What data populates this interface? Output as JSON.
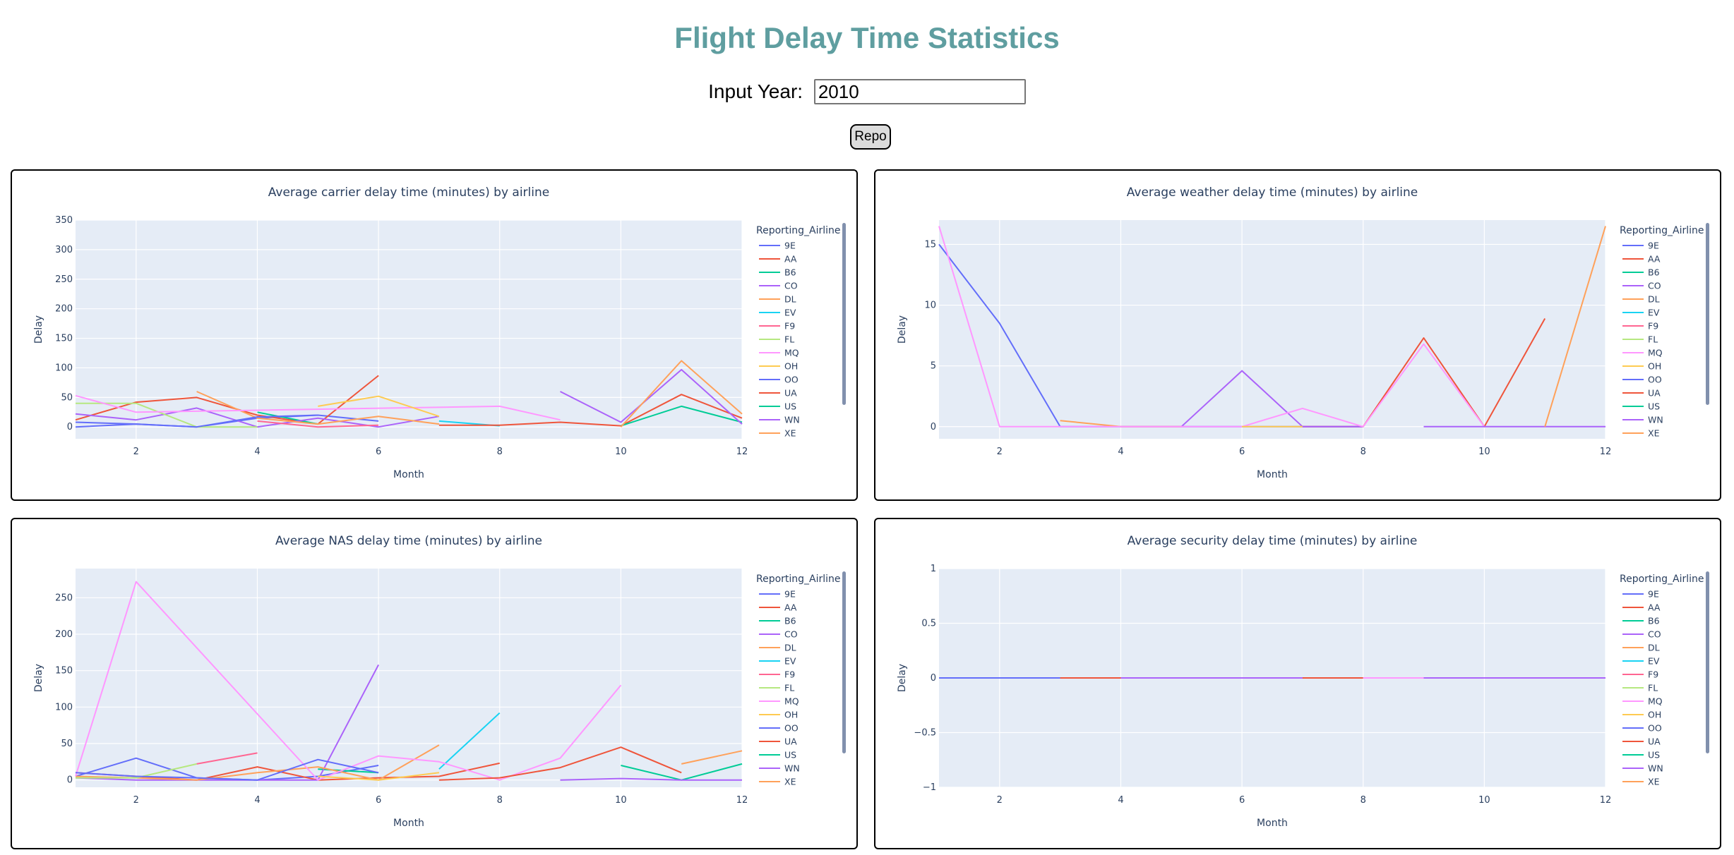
{
  "header": {
    "title": "Flight Delay Time Statistics",
    "year_label": "Input Year:",
    "year_value": "2010",
    "report_label": "Repo"
  },
  "legend_title": "Reporting_Airline",
  "airlines": [
    "9E",
    "AA",
    "B6",
    "CO",
    "DL",
    "EV",
    "F9",
    "FL",
    "MQ",
    "OH",
    "OO",
    "UA",
    "US",
    "WN",
    "XE"
  ],
  "colors": {
    "9E": "#636efa",
    "AA": "#ef553b",
    "B6": "#00cc96",
    "CO": "#ab63fa",
    "DL": "#ffa15a",
    "EV": "#19d3f3",
    "F9": "#ff6692",
    "FL": "#b6e880",
    "MQ": "#ff97ff",
    "OH": "#fecb52",
    "OO": "#636efa",
    "UA": "#ef553b",
    "US": "#00cc96",
    "WN": "#ab63fa",
    "XE": "#ffa15a",
    "plot_bg": "#e5ecf6",
    "title_color": "#5f9ea0"
  },
  "chart_data": [
    {
      "type": "line",
      "title": "Average carrier delay time (minutes) by airline",
      "xlabel": "Month",
      "ylabel": "Delay",
      "xlim": [
        1,
        12
      ],
      "ylim": [
        -20,
        350
      ],
      "xticks": [
        2,
        4,
        6,
        8,
        10,
        12
      ],
      "yticks": [
        0,
        50,
        100,
        150,
        200,
        250,
        300,
        350
      ],
      "ytick_labels": [
        "0",
        "50",
        "100",
        "150",
        "200",
        "250",
        "300",
        "350"
      ],
      "series": [
        {
          "name": "9E",
          "x": [
            1,
            2,
            3,
            4,
            5,
            6
          ],
          "y": [
            8,
            5,
            0,
            15,
            20,
            10
          ]
        },
        {
          "name": "AA",
          "x": [
            1,
            2,
            3,
            4,
            5,
            6
          ],
          "y": [
            12,
            42,
            50,
            20,
            5,
            87
          ]
        },
        {
          "name": "B6",
          "x": [
            4,
            5
          ],
          "y": [
            25,
            5
          ]
        },
        {
          "name": "CO",
          "x": [
            1,
            2,
            3,
            4,
            5,
            6,
            7
          ],
          "y": [
            22,
            12,
            32,
            0,
            15,
            0,
            18
          ]
        },
        {
          "name": "DL",
          "x": [
            3,
            4,
            5,
            6,
            7
          ],
          "y": [
            60,
            15,
            5,
            18,
            5
          ]
        },
        {
          "name": "EV",
          "x": [
            7,
            8
          ],
          "y": [
            10,
            2
          ]
        },
        {
          "name": "F9",
          "x": [
            4,
            5,
            6
          ],
          "y": [
            10,
            0,
            3
          ]
        },
        {
          "name": "FL",
          "x": [
            1,
            2,
            3,
            4
          ],
          "y": [
            40,
            40,
            0,
            0
          ]
        },
        {
          "name": "MQ",
          "x": [
            1,
            2,
            8,
            9
          ],
          "y": [
            53,
            25,
            35,
            12
          ]
        },
        {
          "name": "OH",
          "x": [
            5,
            6,
            7
          ],
          "y": [
            35,
            52,
            18
          ]
        },
        {
          "name": "OO",
          "x": [
            1,
            2,
            3,
            4,
            5
          ],
          "y": [
            0,
            5,
            0,
            17,
            20
          ]
        },
        {
          "name": "UA",
          "x": [
            7,
            8,
            9,
            10,
            11,
            12
          ],
          "y": [
            3,
            3,
            8,
            2,
            55,
            15
          ]
        },
        {
          "name": "US",
          "x": [
            10,
            11,
            12
          ],
          "y": [
            2,
            35,
            8
          ]
        },
        {
          "name": "WN",
          "x": [
            9,
            10,
            11,
            12
          ],
          "y": [
            60,
            8,
            97,
            5
          ]
        },
        {
          "name": "XE",
          "x": [
            10,
            11,
            12
          ],
          "y": [
            0,
            112,
            22
          ]
        }
      ]
    },
    {
      "type": "line",
      "title": "Average weather delay time (minutes) by airline",
      "xlabel": "Month",
      "ylabel": "Delay",
      "xlim": [
        1,
        12
      ],
      "ylim": [
        -1,
        17
      ],
      "xticks": [
        2,
        4,
        6,
        8,
        10,
        12
      ],
      "yticks": [
        0,
        5,
        10,
        15
      ],
      "ytick_labels": [
        "0",
        "5",
        "10",
        "15"
      ],
      "series": [
        {
          "name": "9E",
          "x": [
            1,
            2,
            3,
            4,
            5,
            6,
            7,
            8
          ],
          "y": [
            15,
            8.5,
            0,
            0,
            0,
            0,
            0,
            0
          ]
        },
        {
          "name": "AA",
          "x": [
            7,
            8,
            9,
            10,
            11
          ],
          "y": [
            0,
            0,
            7.3,
            0,
            8.9
          ]
        },
        {
          "name": "CO",
          "x": [
            4,
            5,
            6,
            7,
            8
          ],
          "y": [
            0,
            0,
            4.6,
            0,
            0
          ]
        },
        {
          "name": "DL",
          "x": [
            3,
            4,
            5
          ],
          "y": [
            0.5,
            0,
            0
          ]
        },
        {
          "name": "MQ",
          "x": [
            1,
            2,
            3,
            6,
            7,
            8,
            9,
            10
          ],
          "y": [
            16.5,
            0,
            0,
            0,
            1.5,
            0,
            6.8,
            0
          ]
        },
        {
          "name": "OH",
          "x": [
            6,
            7
          ],
          "y": [
            0,
            0
          ]
        },
        {
          "name": "WN",
          "x": [
            9,
            10,
            11,
            12
          ],
          "y": [
            0,
            0,
            0,
            0
          ]
        },
        {
          "name": "XE",
          "x": [
            11,
            12
          ],
          "y": [
            0,
            16.5
          ]
        }
      ]
    },
    {
      "type": "line",
      "title": "Average NAS delay time (minutes) by airline",
      "xlabel": "Month",
      "ylabel": "Delay",
      "xlim": [
        1,
        12
      ],
      "ylim": [
        -10,
        290
      ],
      "xticks": [
        2,
        4,
        6,
        8,
        10,
        12
      ],
      "yticks": [
        0,
        50,
        100,
        150,
        200,
        250
      ],
      "ytick_labels": [
        "0",
        "50",
        "100",
        "150",
        "200",
        "250"
      ],
      "series": [
        {
          "name": "9E",
          "x": [
            1,
            2,
            3,
            4,
            5,
            6
          ],
          "y": [
            5,
            30,
            3,
            0,
            5,
            20
          ]
        },
        {
          "name": "AA",
          "x": [
            1,
            2,
            3,
            4,
            5,
            6,
            7,
            8
          ],
          "y": [
            10,
            5,
            0,
            18,
            0,
            3,
            5,
            23
          ]
        },
        {
          "name": "B6",
          "x": [
            5,
            6
          ],
          "y": [
            15,
            10
          ]
        },
        {
          "name": "CO",
          "x": [
            1,
            2,
            3,
            4,
            5,
            6
          ],
          "y": [
            3,
            0,
            0,
            0,
            0,
            158
          ]
        },
        {
          "name": "DL",
          "x": [
            1,
            2,
            3,
            4,
            5,
            6,
            7
          ],
          "y": [
            5,
            3,
            0,
            10,
            18,
            0,
            48
          ]
        },
        {
          "name": "EV",
          "x": [
            7,
            8
          ],
          "y": [
            15,
            92
          ]
        },
        {
          "name": "F9",
          "x": [
            3,
            4
          ],
          "y": [
            22,
            37
          ]
        },
        {
          "name": "FL",
          "x": [
            1,
            2,
            3
          ],
          "y": [
            3,
            3,
            22
          ]
        },
        {
          "name": "MQ",
          "x": [
            1,
            2,
            5,
            6,
            7,
            8,
            9,
            10
          ],
          "y": [
            5,
            272,
            0,
            33,
            25,
            0,
            30,
            130
          ]
        },
        {
          "name": "OH",
          "x": [
            5,
            6,
            7
          ],
          "y": [
            5,
            0,
            10
          ]
        },
        {
          "name": "OO",
          "x": [
            1,
            2,
            3,
            4,
            5,
            6
          ],
          "y": [
            10,
            5,
            3,
            0,
            28,
            10
          ]
        },
        {
          "name": "UA",
          "x": [
            7,
            8,
            9,
            10,
            11
          ],
          "y": [
            0,
            3,
            17,
            45,
            10
          ]
        },
        {
          "name": "US",
          "x": [
            10,
            11,
            12
          ],
          "y": [
            20,
            0,
            22
          ]
        },
        {
          "name": "WN",
          "x": [
            9,
            10,
            11,
            12
          ],
          "y": [
            0,
            2,
            0,
            0
          ]
        },
        {
          "name": "XE",
          "x": [
            11,
            12
          ],
          "y": [
            22,
            40
          ]
        }
      ]
    },
    {
      "type": "line",
      "title": "Average security delay time (minutes) by airline",
      "xlabel": "Month",
      "ylabel": "Delay",
      "xlim": [
        1,
        12
      ],
      "ylim": [
        -1,
        1
      ],
      "xticks": [
        2,
        4,
        6,
        8,
        10,
        12
      ],
      "yticks": [
        -1,
        -0.5,
        0,
        0.5,
        1
      ],
      "ytick_labels": [
        "−1",
        "−0.5",
        "0",
        "0.5",
        "1"
      ],
      "series": [
        {
          "name": "9E",
          "x": [
            1,
            2,
            3,
            4,
            5,
            6,
            7,
            8
          ],
          "y": [
            0,
            0,
            0,
            0,
            0,
            0,
            0,
            0
          ]
        },
        {
          "name": "AA",
          "x": [
            3,
            4,
            5,
            6,
            7,
            8
          ],
          "y": [
            0,
            0,
            0,
            0,
            0,
            0
          ]
        },
        {
          "name": "CO",
          "x": [
            4,
            5,
            6,
            7
          ],
          "y": [
            0,
            0,
            0,
            0
          ]
        },
        {
          "name": "MQ",
          "x": [
            8,
            9
          ],
          "y": [
            0,
            0
          ]
        },
        {
          "name": "WN",
          "x": [
            9,
            10,
            11,
            12
          ],
          "y": [
            0,
            0,
            0,
            0
          ]
        }
      ]
    }
  ]
}
